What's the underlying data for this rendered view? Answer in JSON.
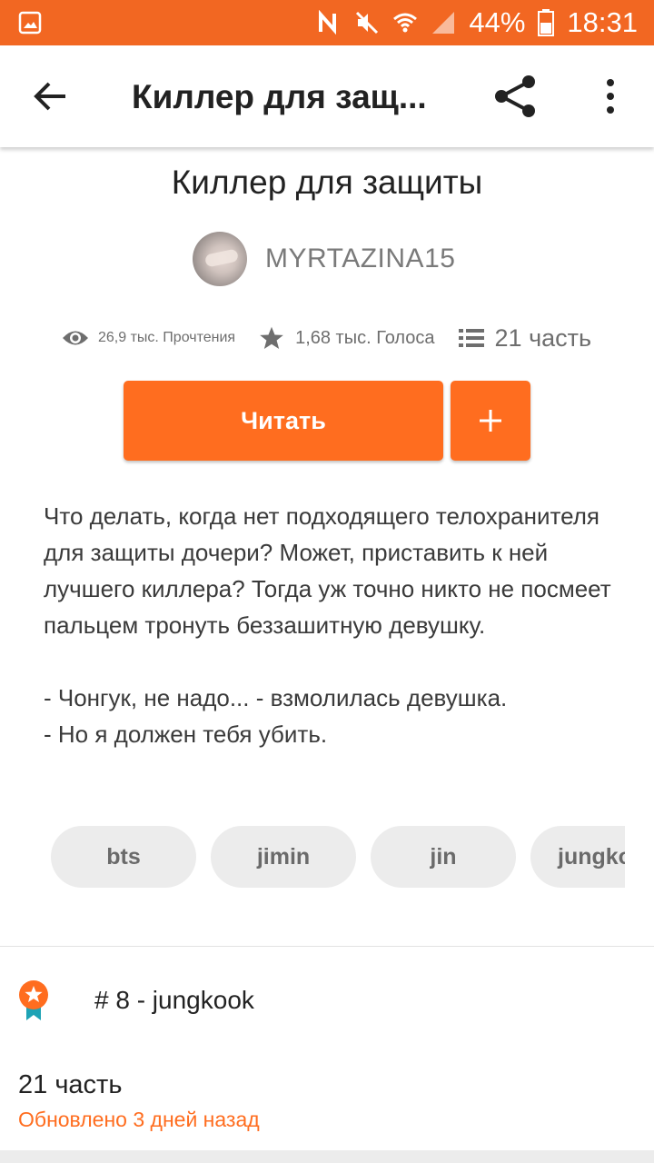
{
  "status_bar": {
    "battery": "44%",
    "time": "18:31",
    "color": "#f26722"
  },
  "app_bar": {
    "title": "Киллер для защ..."
  },
  "story": {
    "title": "Киллер для защиты",
    "author": "MYRTAZINA15",
    "stats": {
      "reads": "26,9 тыс. Прочтения",
      "votes": "1,68 тыс. Голоса",
      "parts": "21 часть"
    },
    "read_button": "Читать",
    "description": "Что делать, когда нет подходящего телохранителя для защиты дочери? Может, приставить к ней лучшего киллера? Тогда уж точно никто не посмеет пальцем тронуть беззашитную девушку.\n\n- Чонгук, не надо... - взмолилась девушка.\n- Но я должен тебя убить.",
    "tags": [
      "bts",
      "jimin",
      "jin",
      "jungkook"
    ],
    "rank": "# 8 - jungkook",
    "parts_count": "21 часть",
    "updated": "Обновлено 3 дней назад"
  },
  "colors": {
    "accent": "#ff6d1f",
    "tag_bg": "#ececec"
  },
  "icons": [
    "gallery-icon",
    "nfc-icon",
    "mute-icon",
    "wifi-icon",
    "signal-icon",
    "battery-icon",
    "back-arrow-icon",
    "share-icon",
    "more-vert-icon",
    "eye-icon",
    "star-icon",
    "list-icon",
    "plus-icon",
    "rank-badge-icon"
  ]
}
